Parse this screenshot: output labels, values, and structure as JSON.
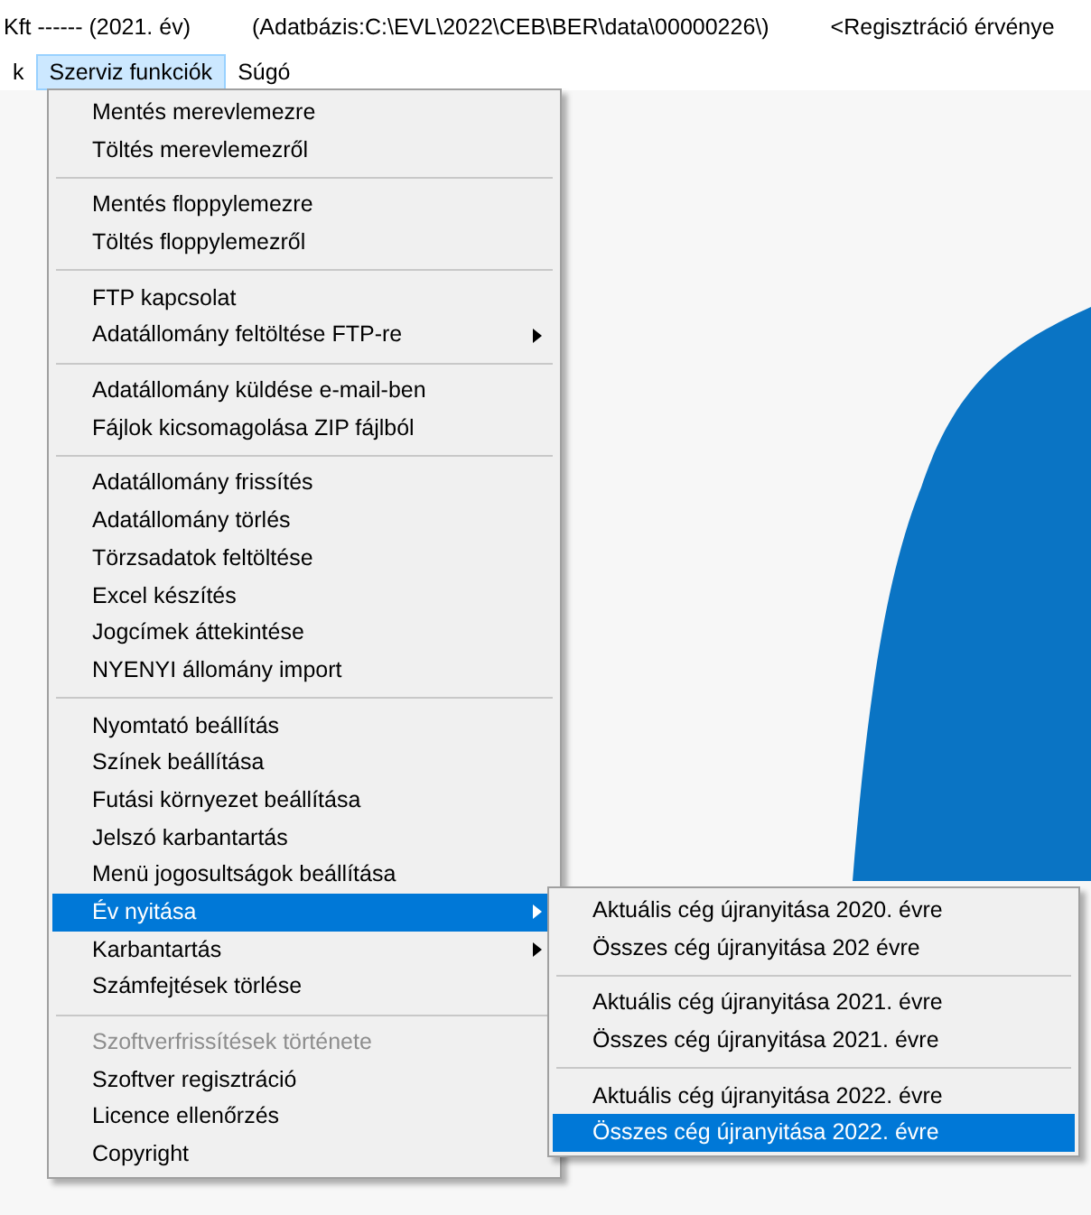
{
  "title_bar": {
    "texts": [
      "Kft  ------  (2021. év)",
      "(Adatbázis:C:\\EVL\\2022\\CEB\\BER\\data\\00000226\\)",
      "<Regisztráció érvénye"
    ]
  },
  "menu_bar": [
    {
      "label": "k",
      "selected": false
    },
    {
      "label": "Szerviz funkciók",
      "selected": true
    },
    {
      "label": "Súgó",
      "selected": false
    }
  ],
  "menu": [
    {
      "kind": "item",
      "label": "Mentés merevlemezre",
      "selected": false,
      "disabled": false,
      "submenu": false
    },
    {
      "kind": "item",
      "label": "Töltés merevlemezről",
      "selected": false,
      "disabled": false,
      "submenu": false
    },
    {
      "kind": "separator"
    },
    {
      "kind": "item",
      "label": "Mentés floppylemezre",
      "selected": false,
      "disabled": false,
      "submenu": false
    },
    {
      "kind": "item",
      "label": "Töltés floppylemezről",
      "selected": false,
      "disabled": false,
      "submenu": false
    },
    {
      "kind": "separator"
    },
    {
      "kind": "item",
      "label": "FTP kapcsolat",
      "selected": false,
      "disabled": false,
      "submenu": false
    },
    {
      "kind": "item",
      "label": "Adatállomány feltöltése FTP-re",
      "selected": false,
      "disabled": false,
      "submenu": true
    },
    {
      "kind": "separator"
    },
    {
      "kind": "item",
      "label": "Adatállomány küldése e-mail-ben",
      "selected": false,
      "disabled": false,
      "submenu": false
    },
    {
      "kind": "item",
      "label": "Fájlok kicsomagolása ZIP fájlból",
      "selected": false,
      "disabled": false,
      "submenu": false
    },
    {
      "kind": "separator"
    },
    {
      "kind": "item",
      "label": "Adatállomány frissítés",
      "selected": false,
      "disabled": false,
      "submenu": false
    },
    {
      "kind": "item",
      "label": "Adatállomány törlés",
      "selected": false,
      "disabled": false,
      "submenu": false
    },
    {
      "kind": "item",
      "label": "Törzsadatok feltöltése",
      "selected": false,
      "disabled": false,
      "submenu": false
    },
    {
      "kind": "item",
      "label": "Excel készítés",
      "selected": false,
      "disabled": false,
      "submenu": false
    },
    {
      "kind": "item",
      "label": "Jogcímek áttekintése",
      "selected": false,
      "disabled": false,
      "submenu": false
    },
    {
      "kind": "item",
      "label": "NYENYI állomány import",
      "selected": false,
      "disabled": false,
      "submenu": false
    },
    {
      "kind": "separator"
    },
    {
      "kind": "item",
      "label": "Nyomtató beállítás",
      "selected": false,
      "disabled": false,
      "submenu": false
    },
    {
      "kind": "item",
      "label": "Színek beállítása",
      "selected": false,
      "disabled": false,
      "submenu": false
    },
    {
      "kind": "item",
      "label": "Futási környezet beállítása",
      "selected": false,
      "disabled": false,
      "submenu": false
    },
    {
      "kind": "item",
      "label": "Jelszó karbantartás",
      "selected": false,
      "disabled": false,
      "submenu": false
    },
    {
      "kind": "item",
      "label": "Menü jogosultságok beállítása",
      "selected": false,
      "disabled": false,
      "submenu": false
    },
    {
      "kind": "item",
      "label": "Év nyitása",
      "selected": true,
      "disabled": false,
      "submenu": true
    },
    {
      "kind": "item",
      "label": "Karbantartás",
      "selected": false,
      "disabled": false,
      "submenu": true
    },
    {
      "kind": "item",
      "label": "Számfejtések törlése",
      "selected": false,
      "disabled": false,
      "submenu": false
    },
    {
      "kind": "separator"
    },
    {
      "kind": "item",
      "label": "Szoftverfrissítések története",
      "selected": false,
      "disabled": true,
      "submenu": false
    },
    {
      "kind": "item",
      "label": "Szoftver regisztráció",
      "selected": false,
      "disabled": false,
      "submenu": false
    },
    {
      "kind": "item",
      "label": "Licence ellenőrzés",
      "selected": false,
      "disabled": false,
      "submenu": false
    },
    {
      "kind": "item",
      "label": "Copyright",
      "selected": false,
      "disabled": false,
      "submenu": false
    }
  ],
  "submenu": [
    {
      "kind": "item",
      "label": "Aktuális cég újranyitása 2020. évre",
      "selected": false
    },
    {
      "kind": "item",
      "label": "Összes cég újranyitása 202 évre",
      "selected": false
    },
    {
      "kind": "separator"
    },
    {
      "kind": "item",
      "label": "Aktuális cég újranyitása 2021. évre",
      "selected": false
    },
    {
      "kind": "item",
      "label": "Összes cég újranyitása 2021. évre",
      "selected": false
    },
    {
      "kind": "separator"
    },
    {
      "kind": "item",
      "label": "Aktuális cég újranyitása 2022. évre",
      "selected": false
    },
    {
      "kind": "item",
      "label": "Összes cég újranyitása 2022. évre",
      "selected": true
    }
  ]
}
